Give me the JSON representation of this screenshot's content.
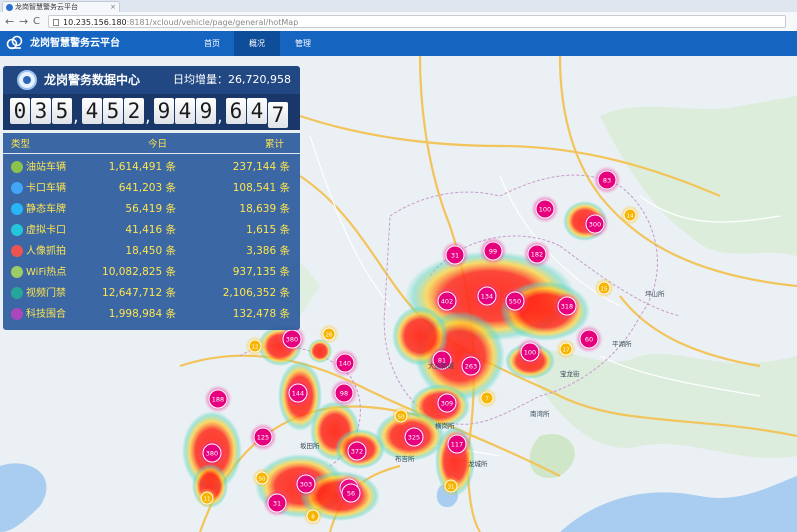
{
  "browser": {
    "tab_title": "龙岗智慧警务云平台",
    "close_glyph": "×",
    "back_glyph": "←",
    "forward_glyph": "→",
    "reload_glyph": "C",
    "url_host": "10.235.156.180",
    "url_rest": ":8181/xcloud/vehicle/page/general/hotMap"
  },
  "app": {
    "title": "龙岗智慧警务云平台",
    "nav": [
      {
        "label": "首页",
        "active": false
      },
      {
        "label": "概况",
        "active": true
      },
      {
        "label": "管理",
        "active": false
      }
    ],
    "accent": "#1565c0"
  },
  "panel": {
    "title": "龙岗警务数据中心",
    "daily_label": "日均增量：26,720,958",
    "counter_digits": [
      "0",
      "3",
      "5",
      ",",
      "4",
      "5",
      "2",
      ",",
      "9",
      "4",
      "9",
      ",",
      "6",
      "4",
      "7"
    ],
    "headers": {
      "type": "类型",
      "today": "今日",
      "total": "累计"
    },
    "rows": [
      {
        "name": "油站车辆",
        "today": "1,614,491 条",
        "total": "237,144 条",
        "icon": "fuel-icon",
        "color": "#8bc34a"
      },
      {
        "name": "卡口车辆",
        "today": "641,203 条",
        "total": "108,541 条",
        "icon": "camera-icon",
        "color": "#42a5f5"
      },
      {
        "name": "静态车牌",
        "today": "56,419 条",
        "total": "18,639 条",
        "icon": "plate-icon",
        "color": "#29b6f6"
      },
      {
        "name": "虚拟卡口",
        "today": "41,416 条",
        "total": "1,615 条",
        "icon": "gate-icon",
        "color": "#26c6da"
      },
      {
        "name": "人像抓拍",
        "today": "18,450 条",
        "total": "3,386 条",
        "icon": "face-icon",
        "color": "#ef5350"
      },
      {
        "name": "WiFi热点",
        "today": "10,082,825 条",
        "total": "937,135 条",
        "icon": "wifi-icon",
        "color": "#9ccc65"
      },
      {
        "name": "视频门禁",
        "today": "12,647,712 条",
        "total": "2,106,352 条",
        "icon": "video-door-icon",
        "color": "#26a69a"
      },
      {
        "name": "科技围合",
        "today": "1,998,984 条",
        "total": "132,478 条",
        "icon": "tech-fence-icon",
        "color": "#ab47bc"
      }
    ]
  },
  "map": {
    "clusters": [
      "402",
      "134",
      "550",
      "318",
      "182",
      "99",
      "31",
      "100",
      "300",
      "83",
      "14",
      "15",
      "17",
      "60",
      "100",
      "263",
      "7",
      "81",
      "309",
      "325",
      "117",
      "31",
      "50",
      "60",
      "372",
      "56",
      "303",
      "31",
      "380",
      "140",
      "98",
      "144",
      "188",
      "125",
      "380",
      "11",
      "8",
      "26",
      "12",
      "50"
    ],
    "place_labels": [
      "大运新城",
      "宝龙街",
      "平湖所",
      "坪山所",
      "横岗所",
      "布吉所",
      "坂田所",
      "南湾所",
      "龙城所"
    ]
  }
}
